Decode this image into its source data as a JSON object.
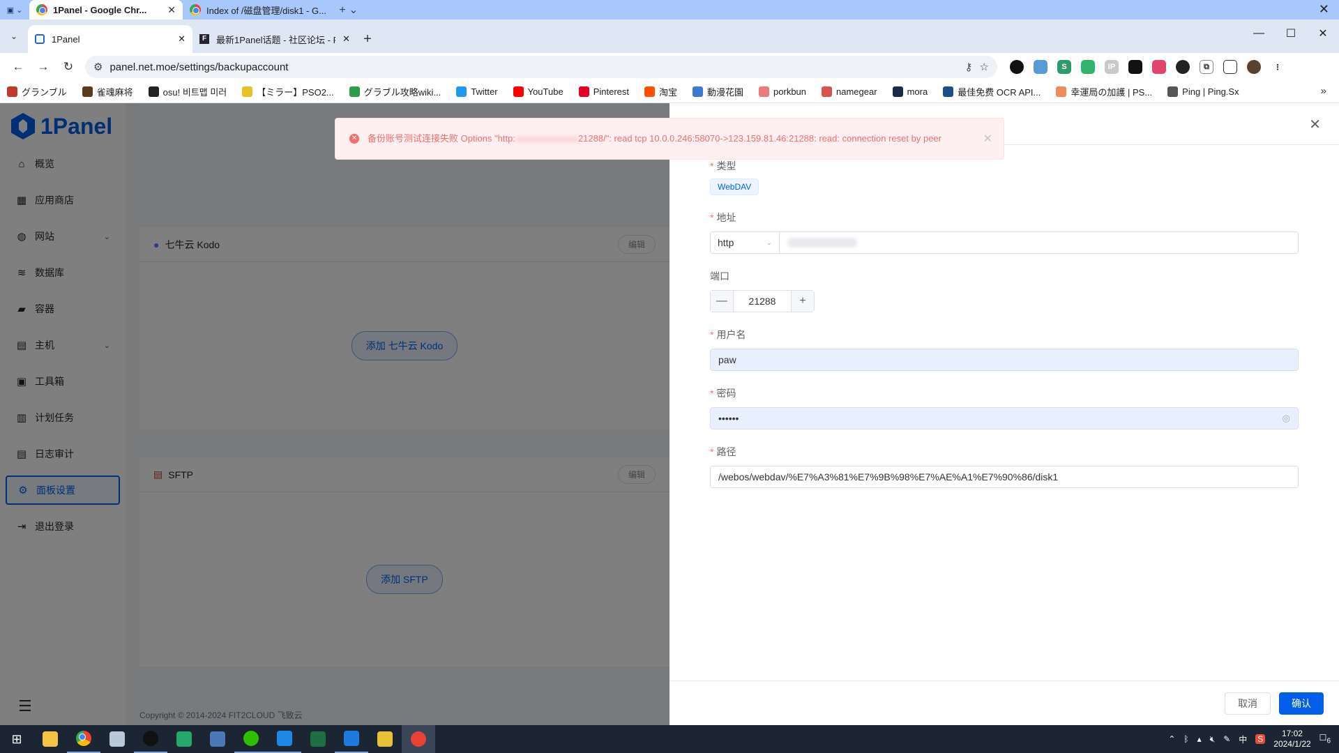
{
  "window_tabs": [
    {
      "title": "1Panel - Google Chr...",
      "active": true
    },
    {
      "title": "Index of /磁盘管理/disk1 - G...",
      "active": false
    }
  ],
  "tabs": [
    {
      "title": "1Panel",
      "active": true
    },
    {
      "title": "最新1Panel话题 - 社区论坛 - F",
      "active": false
    }
  ],
  "address": {
    "url": "panel.net.moe/settings/backupaccount"
  },
  "bookmarks": [
    {
      "label": "グランブル",
      "color": "#c0392b"
    },
    {
      "label": "雀魂麻将",
      "color": "#5a3b1e"
    },
    {
      "label": "osu! 비트맵 미러",
      "color": "#222222"
    },
    {
      "label": "【ミラー】PSO2...",
      "color": "#e6c229"
    },
    {
      "label": "グラブル攻略wiki...",
      "color": "#2e9c4a"
    },
    {
      "label": "Twitter",
      "color": "#1d9bf0"
    },
    {
      "label": "YouTube",
      "color": "#ff0000"
    },
    {
      "label": "Pinterest",
      "color": "#e60023"
    },
    {
      "label": "淘宝",
      "color": "#ff5000"
    },
    {
      "label": "動漫花園",
      "color": "#3a7bd5"
    },
    {
      "label": "porkbun",
      "color": "#ef7878"
    },
    {
      "label": "namegear",
      "color": "#d9534f"
    },
    {
      "label": "mora",
      "color": "#1a2b4a"
    },
    {
      "label": "最佳免费 OCR API...",
      "color": "#1a4e8a"
    },
    {
      "label": "幸運局の加護 | PS...",
      "color": "#f08a5d"
    },
    {
      "label": "Ping | Ping.Sx",
      "color": "#555555"
    }
  ],
  "sidebar": {
    "logo": "1Panel",
    "items": [
      {
        "label": "概览",
        "icon": "home-icon",
        "glyph": "⌂",
        "chevron": false
      },
      {
        "label": "应用商店",
        "icon": "grid-icon",
        "glyph": "▦",
        "chevron": false
      },
      {
        "label": "网站",
        "icon": "globe-icon",
        "glyph": "◍",
        "chevron": true
      },
      {
        "label": "数据库",
        "icon": "layers-icon",
        "glyph": "≋",
        "chevron": false
      },
      {
        "label": "容器",
        "icon": "docker-icon",
        "glyph": "▰",
        "chevron": false
      },
      {
        "label": "主机",
        "icon": "server-icon",
        "glyph": "▤",
        "chevron": true
      },
      {
        "label": "工具箱",
        "icon": "toolbox-icon",
        "glyph": "▣",
        "chevron": false
      },
      {
        "label": "计划任务",
        "icon": "calendar-icon",
        "glyph": "▥",
        "chevron": false
      },
      {
        "label": "日志审计",
        "icon": "log-icon",
        "glyph": "▤",
        "chevron": false
      },
      {
        "label": "面板设置",
        "icon": "settings-icon",
        "glyph": "⚙",
        "chevron": false,
        "active": true
      },
      {
        "label": "退出登录",
        "icon": "logout-icon",
        "glyph": "⇥",
        "chevron": false
      }
    ]
  },
  "main": {
    "cards": [
      {
        "title": "七牛云 Kodo",
        "edit": "编辑",
        "add": "添加 七牛云 Kodo"
      },
      {
        "title": "SFTP",
        "edit": "编辑",
        "add": "添加 SFTP"
      }
    ],
    "footer": "Copyright © 2014-2024 FIT2CLOUD 飞致云"
  },
  "toast": {
    "message_start": "备份账号测试连接失败 Options \"http:",
    "message_end": "21288/\": read tcp 10.0.0.246:58070->123.159.81.46:21288: read: connection reset by peer"
  },
  "form": {
    "type_label": "类型",
    "type_value": "WebDAV",
    "address_label": "地址",
    "protocol": "http",
    "port_label": "端口",
    "port": "21288",
    "username_label": "用户名",
    "username": "paw",
    "password_label": "密码",
    "password_mask": "••••••",
    "path_label": "路径",
    "path": "/webos/webdav/%E7%A3%81%E7%9B%98%E7%AE%A1%E7%90%86/disk1",
    "cancel": "取消",
    "confirm": "确认"
  },
  "tray": {
    "ime": "中",
    "time": "17:02",
    "date": "2024/1/22",
    "notifications": "6"
  },
  "colors": {
    "accent": "#005eeb",
    "error": "#f56c6c"
  }
}
